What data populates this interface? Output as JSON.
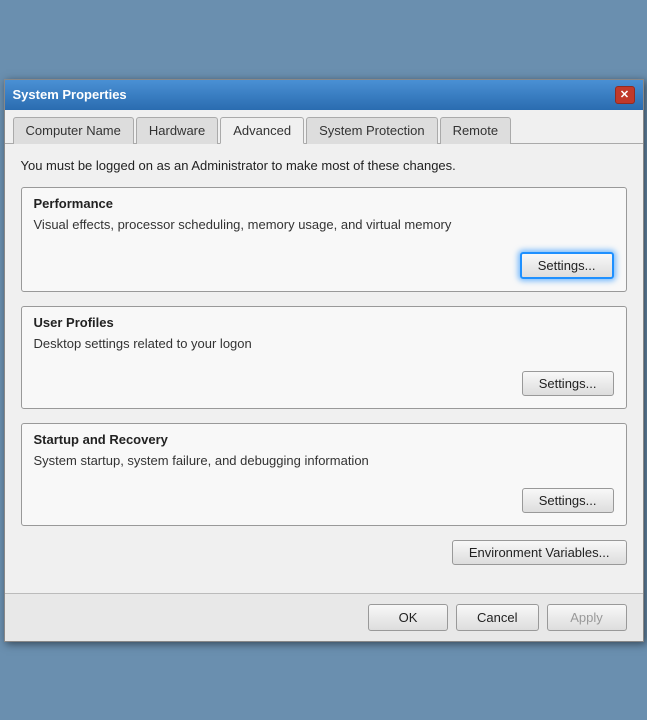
{
  "titleBar": {
    "title": "System Properties",
    "closeLabel": "✕"
  },
  "tabs": [
    {
      "id": "computer-name",
      "label": "Computer Name",
      "active": false
    },
    {
      "id": "hardware",
      "label": "Hardware",
      "active": false
    },
    {
      "id": "advanced",
      "label": "Advanced",
      "active": true
    },
    {
      "id": "system-protection",
      "label": "System Protection",
      "active": false
    },
    {
      "id": "remote",
      "label": "Remote",
      "active": false
    }
  ],
  "content": {
    "infoText": "You must be logged on as an Administrator to make most of these changes.",
    "performance": {
      "label": "Performance",
      "description": "Visual effects, processor scheduling, memory usage, and virtual memory",
      "settingsLabel": "Settings..."
    },
    "userProfiles": {
      "label": "User Profiles",
      "description": "Desktop settings related to your logon",
      "settingsLabel": "Settings..."
    },
    "startupRecovery": {
      "label": "Startup and Recovery",
      "description": "System startup, system failure, and debugging information",
      "settingsLabel": "Settings..."
    },
    "envVariablesLabel": "Environment Variables..."
  },
  "footer": {
    "okLabel": "OK",
    "cancelLabel": "Cancel",
    "applyLabel": "Apply"
  }
}
